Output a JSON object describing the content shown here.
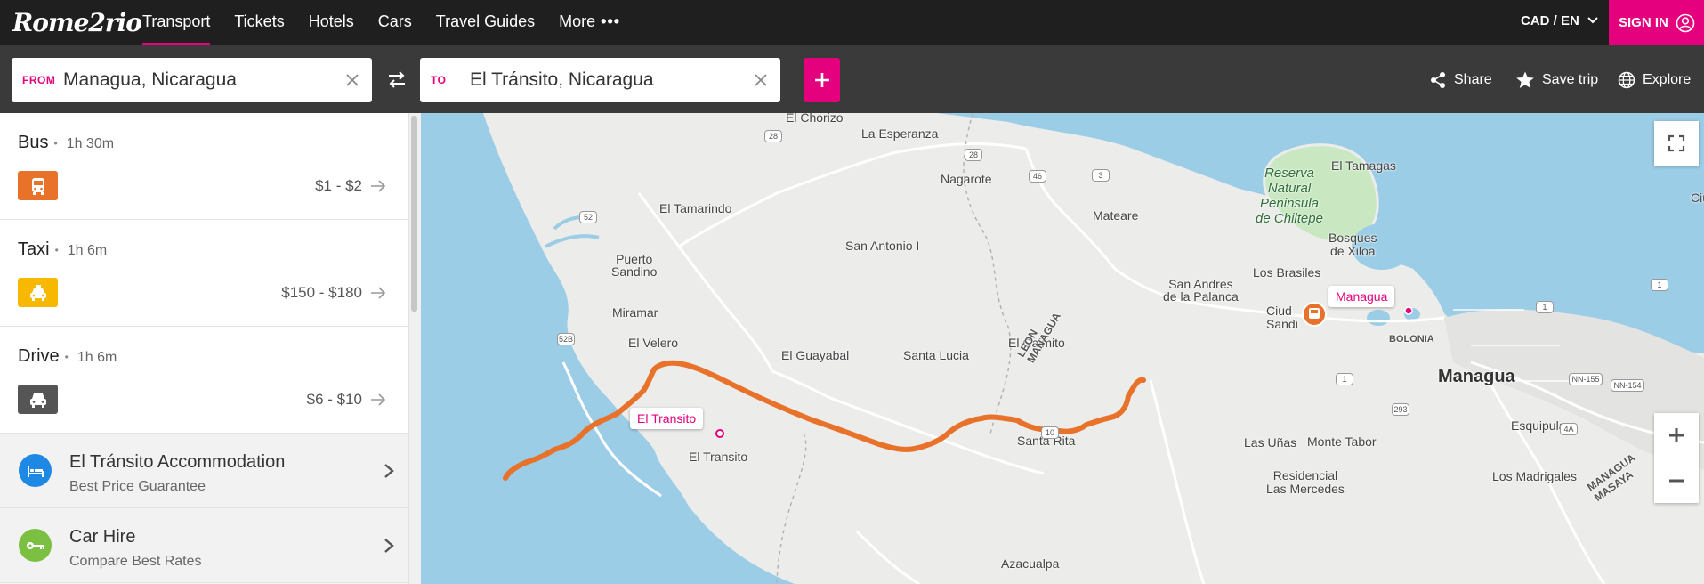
{
  "nav": {
    "logo": "Rome2rio",
    "links": [
      "Transport",
      "Tickets",
      "Hotels",
      "Cars",
      "Travel Guides",
      "More"
    ],
    "currency": "CAD / EN",
    "signin": "SIGN IN"
  },
  "search": {
    "from_label": "FROM",
    "from_value": "Managua, Nicaragua",
    "to_label": "TO",
    "to_value": "El Tránsito, Nicaragua",
    "tools": {
      "share": "Share",
      "save": "Save trip",
      "explore": "Explore"
    }
  },
  "routes": [
    {
      "mode": "Bus",
      "duration": "1h 30m",
      "price": "$1 - $2",
      "color": "#e8722a",
      "icon": "bus-icon"
    },
    {
      "mode": "Taxi",
      "duration": "1h 6m",
      "price": "$150 - $180",
      "color": "#f6b800",
      "icon": "taxi-icon"
    },
    {
      "mode": "Drive",
      "duration": "1h 6m",
      "price": "$6 - $10",
      "color": "#555555",
      "icon": "car-icon"
    }
  ],
  "promos": [
    {
      "title": "El Tránsito Accommodation",
      "subtitle": "Best Price Guarantee",
      "color": "#1e88e5",
      "icon": "bed-icon"
    },
    {
      "title": "Car Hire",
      "subtitle": "Compare Best Rates",
      "color": "#7bc043",
      "icon": "key-icon"
    }
  ],
  "map": {
    "pins": {
      "origin": "Managua",
      "destination": "El Transito"
    },
    "labels": {
      "el_chorizo": "El Chorizo",
      "la_esperanza": "La Esperanza",
      "nagarote": "Nagarote",
      "el_tamarindo": "El Tamarindo",
      "mateare": "Mateare",
      "el_tamagas": "El Tamagas",
      "reserva": "Reserva\nNatural\nPeninsula\nde Chiltepe",
      "san_antonio": "San Antonio I",
      "puerto_sandino": "Puerto\nSandino",
      "bosques": "Bosques\nde Xiloa",
      "los_brasiles": "Los Brasiles",
      "san_andres": "San Andres\nde la Palanca",
      "miramar": "Miramar",
      "ciudad_sandino": "Ciud\nSandi",
      "el_velero": "El Velero",
      "el_guayabal": "El Guayabal",
      "santa_lucia": "Santa Lucia",
      "el_caimito": "El Caimito",
      "leon_managua": "LEON\nMANAGUA",
      "bolonia": "BOLONIA",
      "managua": "Managua",
      "el_transito": "El Transito",
      "santa_rita": "Santa Rita",
      "las_unas": "Las Uñas",
      "monte_tabor": "Monte Tabor",
      "esquipulas": "Esquipulas",
      "residencial": "Residencial\nLas Mercedes",
      "los_madrigales": "Los Madrigales",
      "azacualpa": "Azacualpa",
      "managua_masaya": "MANAGUA\nMASAYA",
      "ciu": "Ciu"
    },
    "road_shields": [
      "3",
      "52",
      "28",
      "28",
      "46",
      "52B",
      "1",
      "1",
      "10",
      "293",
      "NN-155",
      "NN-154",
      "4A",
      "1"
    ]
  }
}
